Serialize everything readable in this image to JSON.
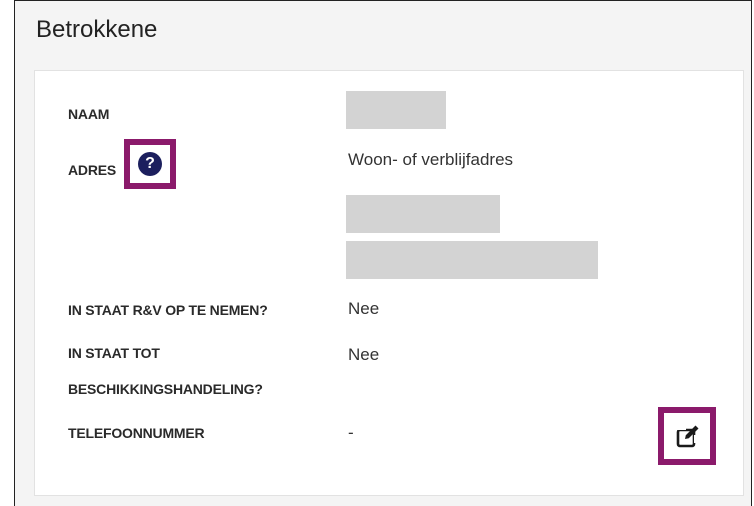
{
  "section": {
    "title": "Betrokkene"
  },
  "fields": {
    "naam": {
      "label": "NAAM"
    },
    "adres": {
      "label": "ADRES",
      "value": "Woon- of verblijfadres"
    },
    "rv": {
      "label": "IN STAAT R&V OP TE NEMEN?",
      "value": "Nee"
    },
    "beschikking": {
      "label_line1": "IN STAAT TOT",
      "label_line2": "BESCHIKKINGSHANDELING?",
      "value": "Nee"
    },
    "telefoon": {
      "label": "TELEFOONNUMMER",
      "value": "-"
    }
  },
  "icons": {
    "help": "question-circle-icon",
    "edit": "edit-icon"
  },
  "colors": {
    "highlight": "#8b1a6b",
    "help_icon_bg": "#1c1f5e",
    "redaction": "#d3d3d3"
  }
}
